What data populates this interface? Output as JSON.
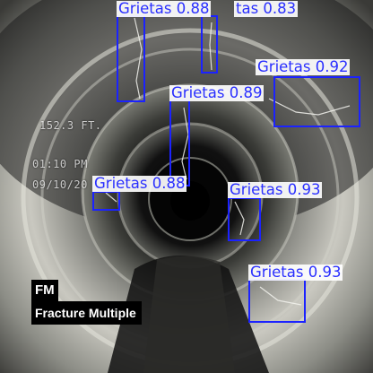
{
  "colors": {
    "box": "#1b22ff",
    "label_text": "#2a2fff",
    "caption_bg": "#000000"
  },
  "overlay": {
    "distance": "152.3 FT.",
    "time": "01:10 PM",
    "date": "09/10/20"
  },
  "detections": [
    {
      "label": "Grietas 0.88"
    },
    {
      "label": "tas 0.83"
    },
    {
      "label": "Grietas 0.92"
    },
    {
      "label": "Grietas 0.89"
    },
    {
      "label": "Grietas 0.88"
    },
    {
      "label": "Grietas 0.93"
    },
    {
      "label": "Grietas 0.93"
    }
  ],
  "caption": {
    "code": "FM",
    "description": "Fracture Multiple"
  }
}
